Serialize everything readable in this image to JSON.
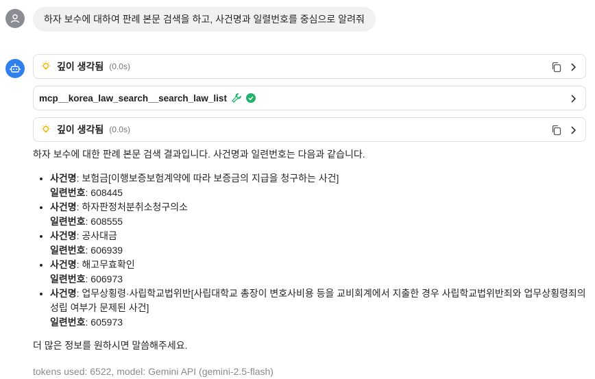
{
  "user_message": "하자 보수에 대하여 판례 본문 검색을 하고, 사건명과 일렬번호를 중심으로 알려줘",
  "blocks": [
    {
      "title": "깊이 생각됨",
      "time": "(0.0s)"
    },
    {
      "title": "mcp__korea_law_search__search_law_list"
    },
    {
      "title": "깊이 생각됨",
      "time": "(0.0s)"
    }
  ],
  "answer": {
    "intro": "하자 보수에 대한 판례 본문 검색 결과입니다. 사건명과 일련번호는 다음과 같습니다.",
    "case_name_label": "사건명",
    "serial_label": "일련번호",
    "cases": [
      {
        "name": ": 보험금[이행보증보험계약에 따라 보증금의 지급을 청구하는 사건]",
        "serial": ": 608445"
      },
      {
        "name": ": 하자판정처분취소청구의소",
        "serial": ": 608555"
      },
      {
        "name": ": 공사대금",
        "serial": ": 606939"
      },
      {
        "name": ": 해고무효확인",
        "serial": ": 606973"
      },
      {
        "name": ": 업무상횡령·사립학교법위반[사립대학교 총장이 변호사비용 등을 교비회계에서 지출한 경우 사립학교법위반죄와 업무상횡령죄의 성립 여부가 문제된 사건]",
        "serial": ": 605973"
      }
    ],
    "closing": "더 많은 정보를 원하시면 말씀해주세요."
  },
  "footer": {
    "tokens": "tokens used: 6522, model: Gemini API (gemini-2.5-flash)"
  },
  "colors": {
    "bot_avatar": "#2f80ed",
    "user_avatar": "#8a8d93",
    "check": "#22b36b",
    "bulb": "#f4b400",
    "wrench": "#22b36b"
  },
  "icons": [
    "user-icon",
    "robot-icon",
    "lightbulb-icon",
    "copy-icon",
    "chevron-right-icon",
    "wrench-icon",
    "check-circle-icon"
  ]
}
